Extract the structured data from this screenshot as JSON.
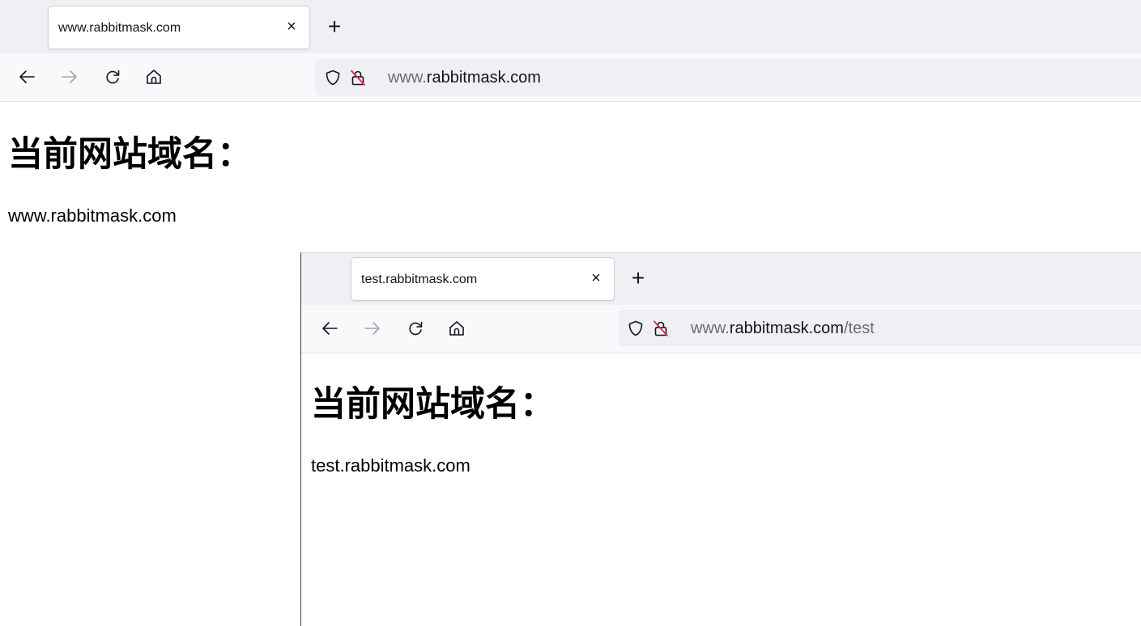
{
  "main_window": {
    "tab": {
      "title": "www.rabbitmask.com",
      "close_label": "×"
    },
    "new_tab_label": "+",
    "url": {
      "prefix": "www.",
      "host": "rabbitmask.com",
      "path": ""
    },
    "page": {
      "heading": "当前网站域名：",
      "domain": "www.rabbitmask.com"
    }
  },
  "second_window": {
    "tab": {
      "title": "test.rabbitmask.com",
      "close_label": "×"
    },
    "new_tab_label": "+",
    "url": {
      "prefix": "www.",
      "host": "rabbitmask.com",
      "path": "/test"
    },
    "page": {
      "heading": "当前网站域名：",
      "domain": "test.rabbitmask.com"
    }
  },
  "icons": {
    "back": "arrow-left-icon",
    "forward": "arrow-right-icon",
    "reload": "reload-icon",
    "home": "home-icon",
    "shield": "shield-icon",
    "insecure_lock": "insecure-lock-icon"
  },
  "colors": {
    "tabstrip": "#f0f0f4",
    "navbar": "#f9f9fb",
    "urlbar": "#f0f0f4",
    "insecure_slash": "#e22850",
    "text": "#15141a",
    "dim_text": "#6b6b72"
  }
}
